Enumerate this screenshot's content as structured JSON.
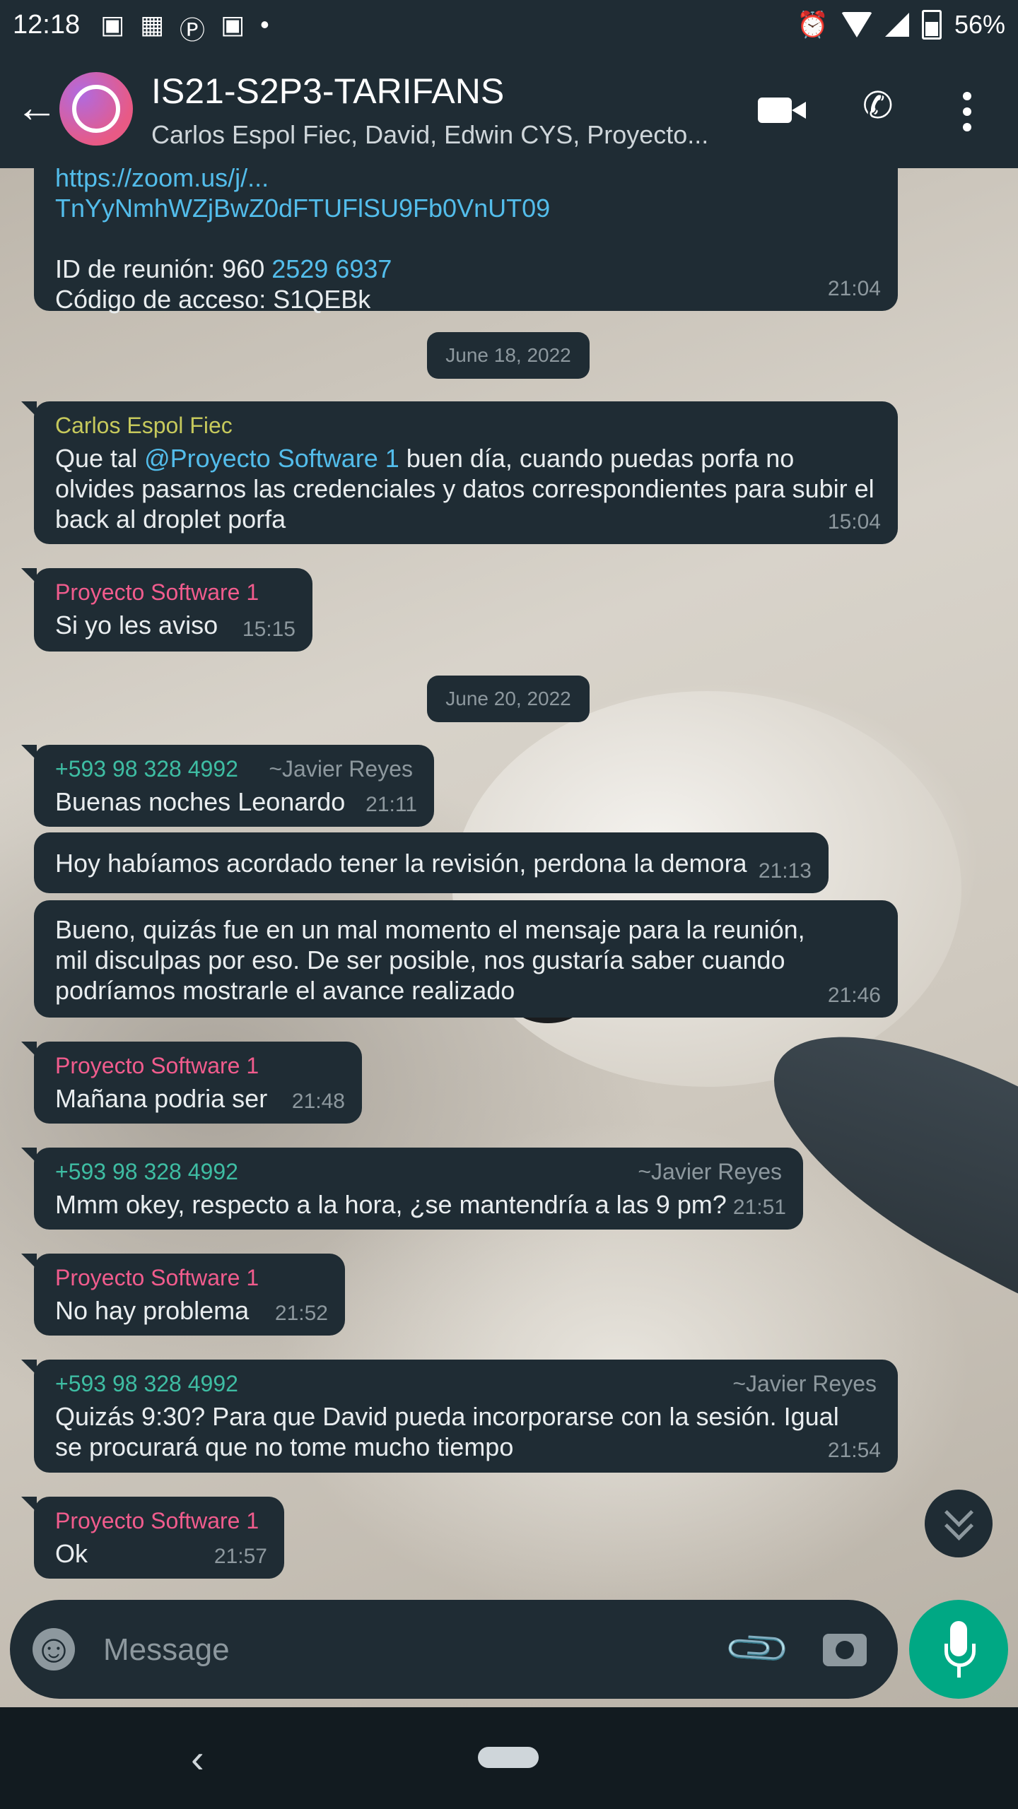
{
  "status_bar": {
    "time": "12:18",
    "battery": "56%"
  },
  "header": {
    "title": "IS21-S2P3-TARIFANS",
    "subtitle": "Carlos Espol Fiec, David, Edwin CYS, Proyecto..."
  },
  "messages": [
    {
      "link_line1": "https://zoom.us/j/...",
      "link_line2": "TnYyNmhWZjBwZ0dFTUFlSU9Fb0VnUT09",
      "id_label": "ID de reunión: 960 ",
      "id_link": "2529 6937",
      "code_line": "Código de acceso: S1QEBk",
      "time": "21:04"
    },
    {
      "date": "June 18, 2022"
    },
    {
      "sender": "Carlos Espol Fiec",
      "text_pre": "Que tal ",
      "mention": "@Proyecto Software 1",
      "text_post": " buen día, cuando puedas porfa no olvides pasarnos las credenciales y datos correspondientes para subir el back al droplet porfa",
      "time": "15:04"
    },
    {
      "sender": "Proyecto Software 1",
      "text": "Si yo les aviso",
      "time": "15:15"
    },
    {
      "date": "June 20, 2022"
    },
    {
      "sender": "+593 98 328 4992",
      "alias": "~Javier Reyes",
      "text": "Buenas noches Leonardo",
      "time": "21:11"
    },
    {
      "text": "Hoy habíamos acordado tener la revisión, perdona la demora",
      "time": "21:13"
    },
    {
      "text": "Bueno, quizás fue en un mal momento el mensaje para la reunión, mil disculpas por eso. De ser posible, nos gustaría saber cuando podríamos mostrarle el avance realizado",
      "time": "21:46"
    },
    {
      "sender": "Proyecto Software 1",
      "text": "Mañana podria ser",
      "time": "21:48"
    },
    {
      "sender": "+593 98 328 4992",
      "alias": "~Javier Reyes",
      "text": "Mmm okey, respecto a la hora, ¿se mantendría a las 9 pm?",
      "time": "21:51"
    },
    {
      "sender": "Proyecto Software 1",
      "text": "No hay problema",
      "time": "21:52"
    },
    {
      "sender": "+593 98 328 4992",
      "alias": "~Javier Reyes",
      "text": "Quizás 9:30? Para que David pueda incorporarse con la sesión. Igual se procurará que no tome mucho tiempo",
      "time": "21:54"
    },
    {
      "sender": "Proyecto Software 1",
      "text": "Ok",
      "time": "21:57"
    }
  ],
  "composer": {
    "placeholder": "Message"
  },
  "colors": {
    "bubble": "#1f2c34",
    "accent": "#00a884",
    "link": "#53bdeb",
    "sender_carlos": "#c6c95c",
    "sender_proyecto": "#f15c8d",
    "sender_javier": "#3ebda3"
  },
  "icons": [
    "back-arrow-icon",
    "video-call-icon",
    "phone-icon",
    "more-vert-icon",
    "emoji-icon",
    "attach-icon",
    "camera-icon",
    "mic-icon",
    "scroll-down-icon"
  ]
}
